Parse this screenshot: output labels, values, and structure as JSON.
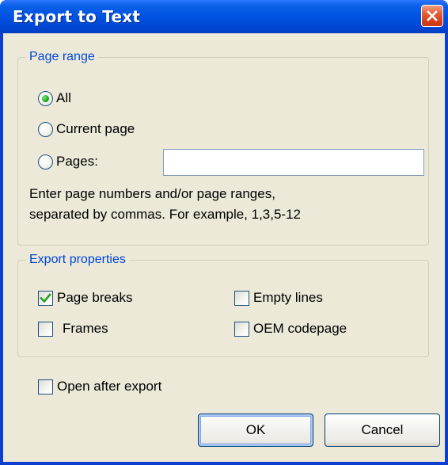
{
  "window": {
    "title": "Export to Text"
  },
  "page_range": {
    "legend": "Page range",
    "options": [
      {
        "label": "All",
        "selected": true
      },
      {
        "label": "Current page",
        "selected": false
      },
      {
        "label": "Pages:",
        "selected": false
      }
    ],
    "pages_value": "",
    "help_lines": [
      "Enter page numbers and/or page ranges,",
      "separated by commas. For example, 1,3,5-12"
    ]
  },
  "export_properties": {
    "legend": "Export properties",
    "page_breaks": {
      "label": "Page breaks",
      "checked": true
    },
    "frames": {
      "label": "Frames",
      "checked": false
    },
    "empty_lines": {
      "label": "Empty lines",
      "checked": false
    },
    "oem_codepage": {
      "label": "OEM codepage",
      "checked": false
    }
  },
  "open_after_export": {
    "label": "Open after export",
    "checked": false
  },
  "buttons": {
    "ok": "OK",
    "cancel": "Cancel"
  },
  "icons": {
    "close": "close-icon",
    "radio_selected": "radio-dot-icon",
    "checkmark": "checkmark-icon"
  },
  "colors": {
    "titlebar": "#0053e0",
    "client_bg": "#ece9d8",
    "legend_text": "#0046d5",
    "close_button": "#d9431c",
    "radio_dot": "#21a121",
    "checkmark": "#21a121"
  }
}
